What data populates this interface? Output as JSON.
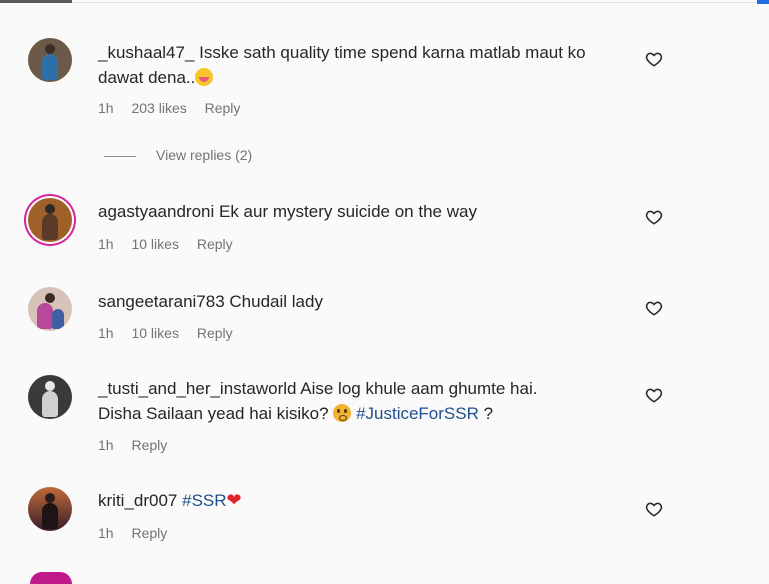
{
  "comments": [
    {
      "username": "_kushaal47_",
      "text": "Isske sath quality time spend karna matlab maut ko dawat dena..",
      "time": "1h",
      "likes": "203 likes",
      "reply": "Reply",
      "avatar_icon": "profile-avatar",
      "view_replies": "View replies (2)"
    },
    {
      "username": "agastyaandroni",
      "text": "Ek aur mystery suicide on the way",
      "time": "1h",
      "likes": "10 likes",
      "reply": "Reply",
      "avatar_icon": "profile-avatar"
    },
    {
      "username": "sangeetarani783",
      "text": "Chudail lady",
      "time": "1h",
      "likes": "10 likes",
      "reply": "Reply",
      "avatar_icon": "profile-avatar"
    },
    {
      "username": "_tusti_and_her_instaworld",
      "text_line1": "Aise log khule aam ghumte hai.",
      "text_line2": "Disha Sailaan yead hai kisiko?",
      "hashtag": "#JusticeForSSR",
      "trail": "?",
      "time": "1h",
      "reply": "Reply",
      "avatar_icon": "profile-avatar"
    },
    {
      "username": "kriti_dr007",
      "hashtag": "#SSR",
      "time": "1h",
      "reply": "Reply",
      "avatar_icon": "profile-avatar"
    }
  ],
  "icons": {
    "like": "heart-outline-icon",
    "emoji_laugh": "laughing-emoji-icon",
    "emoji_flushed": "flushed-emoji-icon",
    "red_heart": "red-heart-emoji-icon"
  },
  "colors": {
    "text": "#262626",
    "meta": "#737373",
    "hashtag": "#1f4f8f",
    "story_ring": "#d6249f"
  }
}
